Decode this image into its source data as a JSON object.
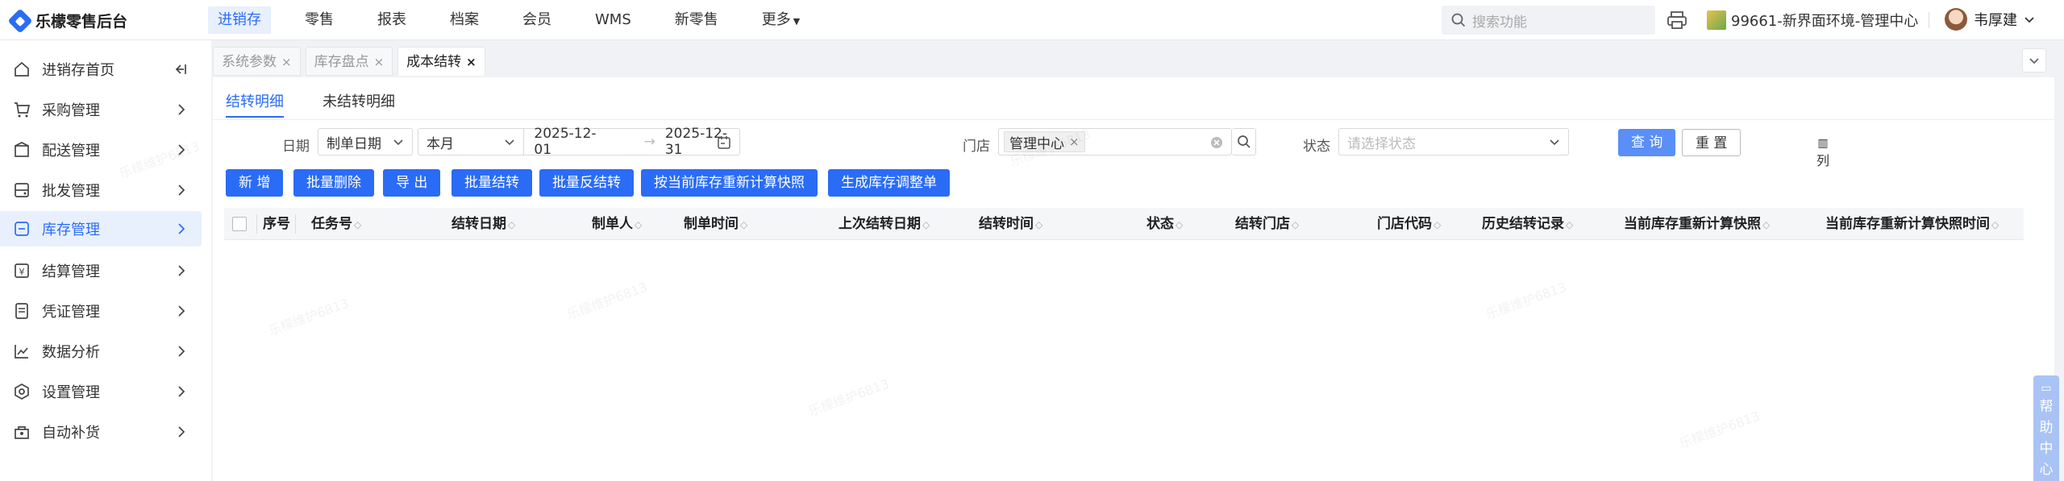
{
  "app": {
    "logo_text": "乐檬零售后台"
  },
  "topnav": [
    "进销存",
    "零售",
    "报表",
    "档案",
    "会员",
    "WMS",
    "新零售",
    "更多"
  ],
  "search": {
    "placeholder": "搜索功能"
  },
  "store": {
    "label": "99661-新界面环境-管理中心"
  },
  "user": {
    "name": "韦厚建"
  },
  "sidebar": [
    {
      "label": "进销存首页",
      "icon": "home-icon"
    },
    {
      "label": "采购管理",
      "icon": "cart-icon"
    },
    {
      "label": "配送管理",
      "icon": "delivery-icon"
    },
    {
      "label": "批发管理",
      "icon": "wholesale-icon"
    },
    {
      "label": "库存管理",
      "icon": "inventory-icon"
    },
    {
      "label": "结算管理",
      "icon": "settlement-icon"
    },
    {
      "label": "凭证管理",
      "icon": "voucher-icon"
    },
    {
      "label": "数据分析",
      "icon": "chart-icon"
    },
    {
      "label": "设置管理",
      "icon": "settings-icon"
    },
    {
      "label": "自动补货",
      "icon": "replenish-icon"
    }
  ],
  "tabs": [
    "系统参数",
    "库存盘点",
    "成本结转"
  ],
  "subtabs": [
    "结转明细",
    "未结转明细"
  ],
  "filters": {
    "date_label": "日期",
    "date_type": "制单日期",
    "period": "本月",
    "start_date": "2025-12-01",
    "end_date": "2025-12-31",
    "store_label": "门店",
    "store_chip": "管理中心",
    "status_label": "状态",
    "status_placeholder": "请选择状态"
  },
  "query_buttons": {
    "query": "查 询",
    "reset": "重 置"
  },
  "actions": [
    "新 增",
    "批量删除",
    "导 出",
    "批量结转",
    "批量反结转",
    "按当前库存重新计算快照",
    "生成库存调整单"
  ],
  "columns": [
    "序号",
    "任务号",
    "结转日期",
    "制单人",
    "制单时间",
    "上次结转日期",
    "结转时间",
    "状态",
    "结转门店",
    "门店代码",
    "历史结转记录",
    "当前库存重新计算快照",
    "当前库存重新计算快照时间"
  ],
  "column_toggle": "列",
  "help": "帮助中心",
  "watermark": "乐檬维护6813",
  "colors": {
    "accent": "#2a6cf6"
  }
}
